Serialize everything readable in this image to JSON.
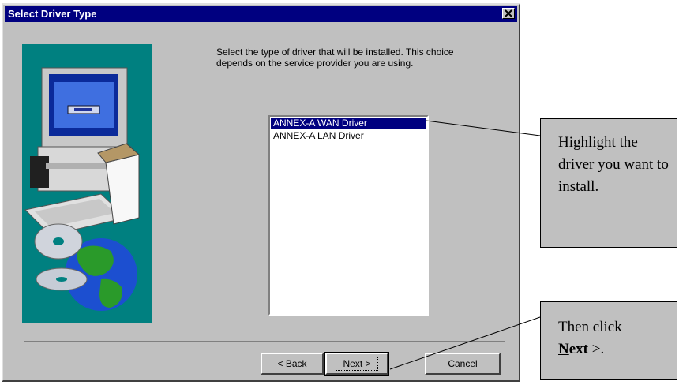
{
  "window": {
    "title": "Select Driver Type",
    "close_icon": "close-x-icon"
  },
  "main": {
    "instructions": "Select the type of driver that will be installed.  This choice depends on the service provider you are using.",
    "drivers": [
      {
        "label": "ANNEX-A WAN Driver",
        "selected": true
      },
      {
        "label": "ANNEX-A LAN Driver",
        "selected": false
      }
    ],
    "side_image_icons": [
      "computer-icon",
      "cd-disc-icon",
      "globe-icon"
    ]
  },
  "buttons": {
    "back": {
      "pre": "< ",
      "mnemonic": "B",
      "rest": "ack"
    },
    "next": {
      "mnemonic": "N",
      "rest": "ext >"
    },
    "cancel": "Cancel"
  },
  "callouts": {
    "highlight": "Highlight the driver you want to install.",
    "then_click_prefix": "Then click",
    "then_click_mnemonic": "N",
    "then_click_bold": "ext",
    "then_click_suffix": " >."
  },
  "colors": {
    "title_bar": "#000080",
    "dialog_face": "#c0c0c0",
    "image_panel": "#008080",
    "selection": "#000080"
  }
}
